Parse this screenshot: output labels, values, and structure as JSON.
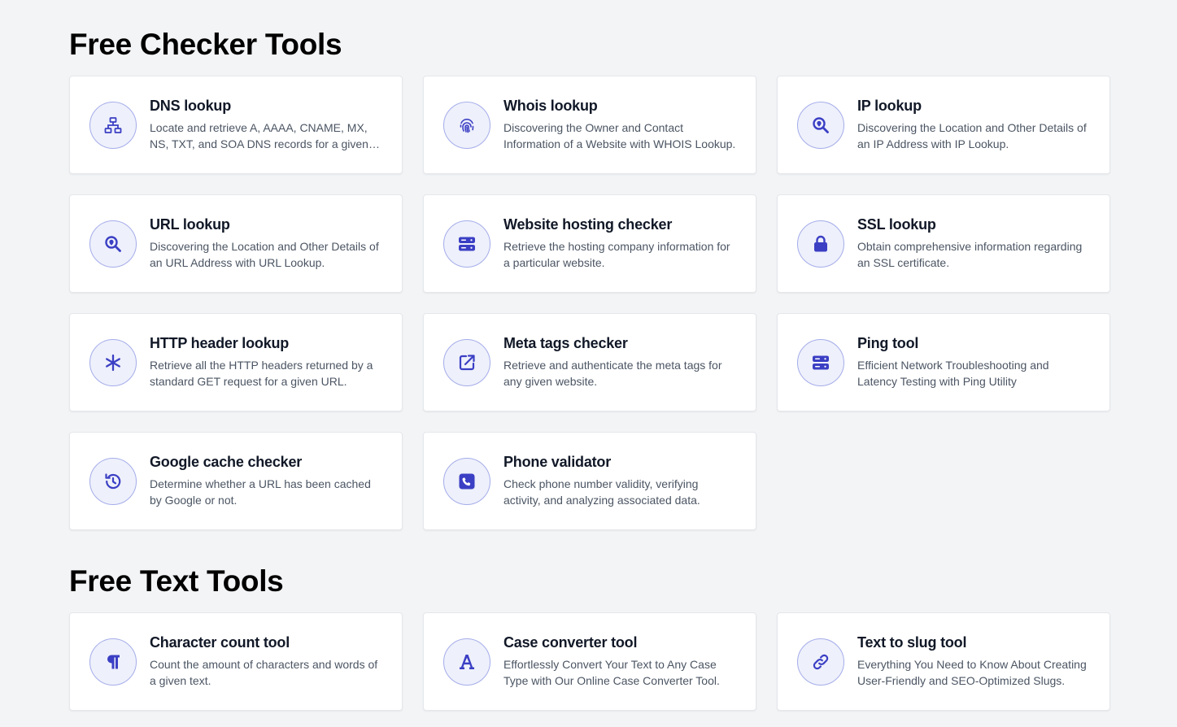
{
  "sections": [
    {
      "title": "Free Checker Tools",
      "tools": [
        {
          "title": "DNS lookup",
          "description": "Locate and retrieve A, AAAA, CNAME, MX, NS, TXT, and SOA DNS records for a given domain.",
          "icon": "network-icon"
        },
        {
          "title": "Whois lookup",
          "description": "Discovering the Owner and Contact Information of a Website with WHOIS Lookup.",
          "icon": "fingerprint-icon"
        },
        {
          "title": "IP lookup",
          "description": "Discovering the Location and Other Details of an IP Address with IP Lookup.",
          "icon": "location-search-icon"
        },
        {
          "title": "URL lookup",
          "description": "Discovering the Location and Other Details of an URL Address with URL Lookup.",
          "icon": "location-search-icon"
        },
        {
          "title": "Website hosting checker",
          "description": "Retrieve the hosting company information for a particular website.",
          "icon": "server-icon"
        },
        {
          "title": "SSL lookup",
          "description": "Obtain comprehensive information regarding an SSL certificate.",
          "icon": "lock-icon"
        },
        {
          "title": "HTTP header lookup",
          "description": "Retrieve all the HTTP headers returned by a standard GET request for a given URL.",
          "icon": "asterisk-icon"
        },
        {
          "title": "Meta tags checker",
          "description": "Retrieve and authenticate the meta tags for any given website.",
          "icon": "external-link-icon"
        },
        {
          "title": "Ping tool",
          "description": "Efficient Network Troubleshooting and Latency Testing with Ping Utility",
          "icon": "server-icon"
        },
        {
          "title": "Google cache checker",
          "description": "Determine whether a URL has been cached by Google or not.",
          "icon": "history-icon"
        },
        {
          "title": "Phone validator",
          "description": "Check phone number validity, verifying activity, and analyzing associated data.",
          "icon": "phone-icon"
        }
      ]
    },
    {
      "title": "Free Text Tools",
      "tools": [
        {
          "title": "Character count tool",
          "description": "Count the amount of characters and words of a given text.",
          "icon": "pilcrow-icon"
        },
        {
          "title": "Case converter tool",
          "description": "Effortlessly Convert Your Text to Any Case Type with Our Online Case Converter Tool.",
          "icon": "font-icon"
        },
        {
          "title": "Text to slug tool",
          "description": "Everything You Need to Know About Creating User-Friendly and SEO-Optimized Slugs.",
          "icon": "link-icon"
        }
      ]
    }
  ],
  "colors": {
    "accent": "#3b3fc4",
    "icon_bg": "#eef0fb",
    "icon_border": "#a5adea",
    "page_bg": "#f3f4f6"
  }
}
